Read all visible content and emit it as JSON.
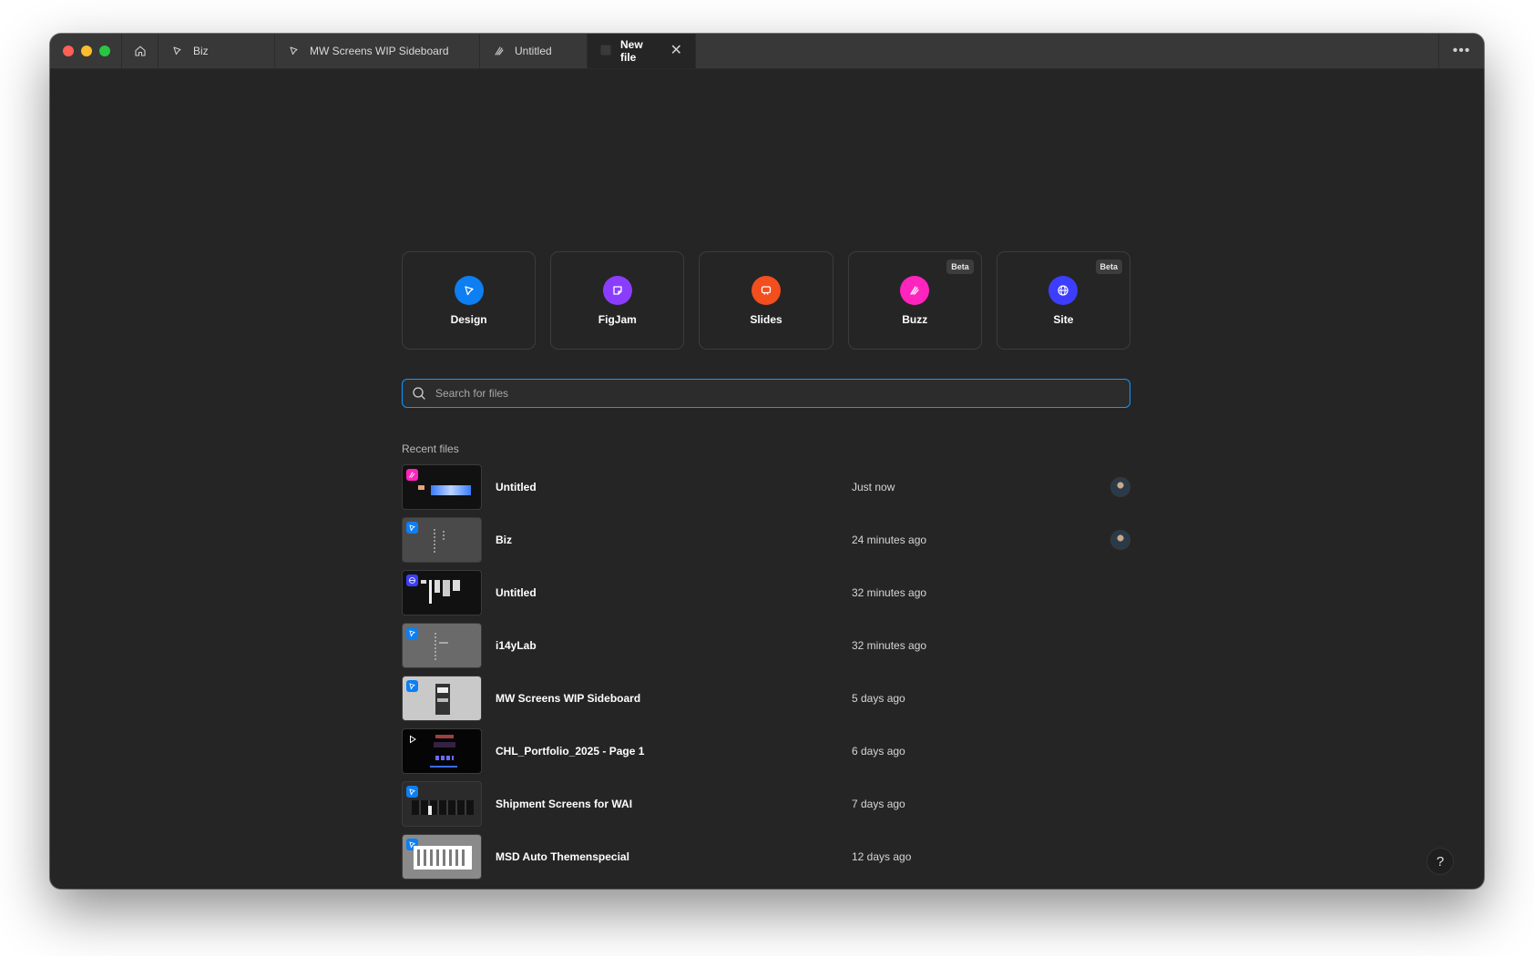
{
  "tabs": [
    {
      "label": "Biz",
      "icon": "design-icon"
    },
    {
      "label": "MW Screens WIP Sideboard",
      "icon": "design-icon"
    },
    {
      "label": "Untitled",
      "icon": "buzz-icon"
    },
    {
      "label": "New file",
      "icon": "new-file-icon",
      "active": true
    }
  ],
  "creators": [
    {
      "label": "Design",
      "color": "#0d7ff2",
      "beta": ""
    },
    {
      "label": "FigJam",
      "color": "#8b3dff",
      "beta": ""
    },
    {
      "label": "Slides",
      "color": "#f24e1e",
      "beta": ""
    },
    {
      "label": "Buzz",
      "color": "#ff24bd",
      "beta": "Beta"
    },
    {
      "label": "Site",
      "color": "#3d3dff",
      "beta": "Beta"
    }
  ],
  "search": {
    "placeholder": "Search for files"
  },
  "recent": {
    "title": "Recent files",
    "files": [
      {
        "name": "Untitled",
        "time": "Just now",
        "type": "buzz",
        "thumb_bg": "#111111",
        "avatar": true
      },
      {
        "name": "Biz",
        "time": "24 minutes ago",
        "type": "design",
        "thumb_bg": "#4a4a4a",
        "avatar": true
      },
      {
        "name": "Untitled",
        "time": "32 minutes ago",
        "type": "site",
        "thumb_bg": "#111111",
        "avatar": false
      },
      {
        "name": "i14yLab",
        "time": "32 minutes ago",
        "type": "design",
        "thumb_bg": "#6a6a6a",
        "avatar": false
      },
      {
        "name": "MW Screens WIP Sideboard",
        "time": "5 days ago",
        "type": "design",
        "thumb_bg": "#c9c9c9",
        "avatar": false
      },
      {
        "name": "CHL_Portfolio_2025 - Page 1",
        "time": "6 days ago",
        "type": "slides",
        "thumb_bg": "#050505",
        "avatar": false
      },
      {
        "name": "Shipment Screens for WAI",
        "time": "7 days ago",
        "type": "design",
        "thumb_bg": "#2b2b2b",
        "avatar": false
      },
      {
        "name": "MSD Auto Themenspecial",
        "time": "12 days ago",
        "type": "design",
        "thumb_bg": "#8a8a8a",
        "avatar": false
      }
    ]
  },
  "help": {
    "label": "?"
  }
}
